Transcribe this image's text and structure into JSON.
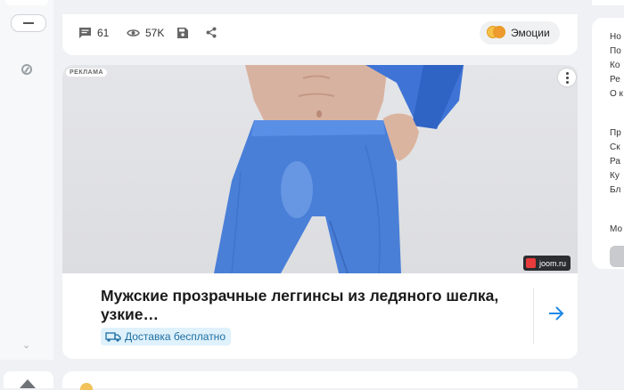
{
  "post_actions": {
    "comments_count": "61",
    "views_count": "57K",
    "emotions_label": "Эмоции"
  },
  "ad": {
    "label": "РЕКЛАМА",
    "source": "joom.ru",
    "headline": "Мужские прозрачные леггинсы из ледяного шелка, узкие…",
    "delivery_badge": "Доставка бесплатно"
  },
  "right_menu": {
    "links_group1": [
      "Но",
      "По",
      "Ко",
      "Ре",
      "О к"
    ],
    "links_group2": [
      "Пр",
      "Ск",
      "Ра",
      "Ку",
      "Бл"
    ],
    "more": "Мо"
  },
  "colors": {
    "accent_blue": "#1e88e5",
    "delivery_bg": "#dff1fb",
    "leggings_blue": "#4a7fd8"
  },
  "icons": [
    "compass-icon",
    "comment-icon",
    "eye-icon",
    "bookmark-icon",
    "share-icon",
    "truck-icon",
    "arrow-right-icon",
    "more-vertical-icon"
  ]
}
